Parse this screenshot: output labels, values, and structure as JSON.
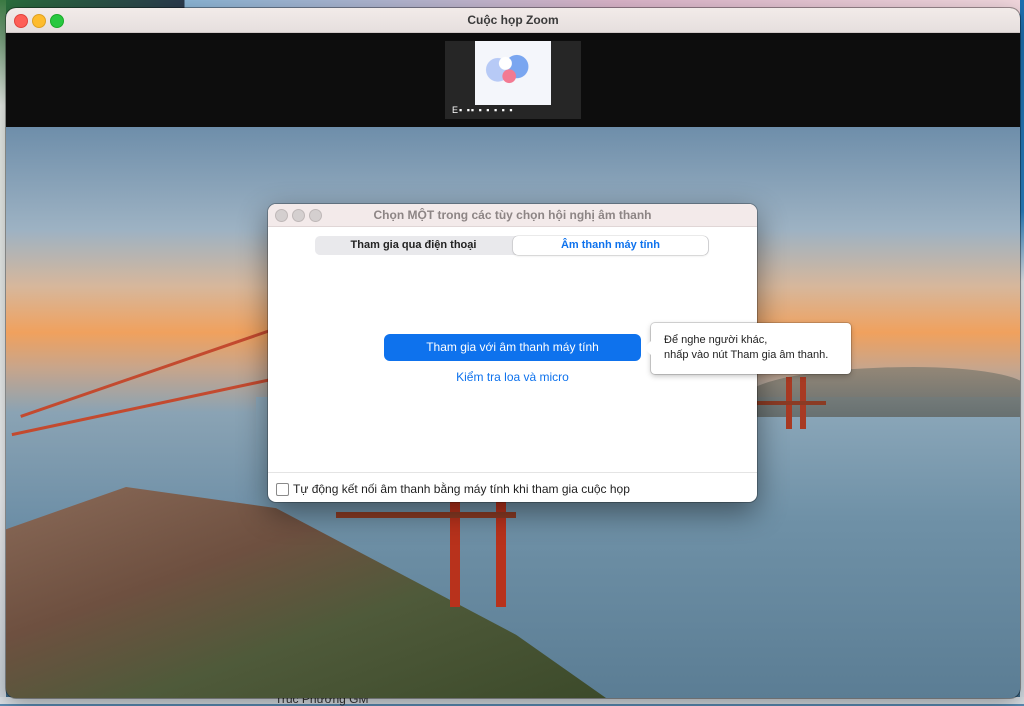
{
  "window": {
    "title": "Cuộc họp Zoom"
  },
  "participant": {
    "name": "E▪ ▪▪ ▪ ▪ ▪ ▪ ▪"
  },
  "dialog": {
    "title": "Chọn MỘT trong các tùy chọn hội nghị âm thanh",
    "tabs": [
      {
        "label": "Tham gia qua điện thoại",
        "selected": false
      },
      {
        "label": "Âm thanh máy tính",
        "selected": true
      }
    ],
    "join_button": "Tham gia với âm thanh máy tính",
    "test_link": "Kiểm tra loa và micro",
    "auto_connect_label": "Tự động kết nối âm thanh bằng máy tính khi tham gia cuộc họp",
    "auto_connect_checked": false
  },
  "tooltip": {
    "line1": "Để nghe người khác,",
    "line2": "nhấp vào nút Tham gia âm thanh."
  },
  "desktop": {
    "bottom_text": "Trúc Phương GM"
  },
  "colors": {
    "accent": "#0e72ed",
    "close": "#fe5f57",
    "minimize": "#febc2e",
    "zoom": "#28c840"
  }
}
